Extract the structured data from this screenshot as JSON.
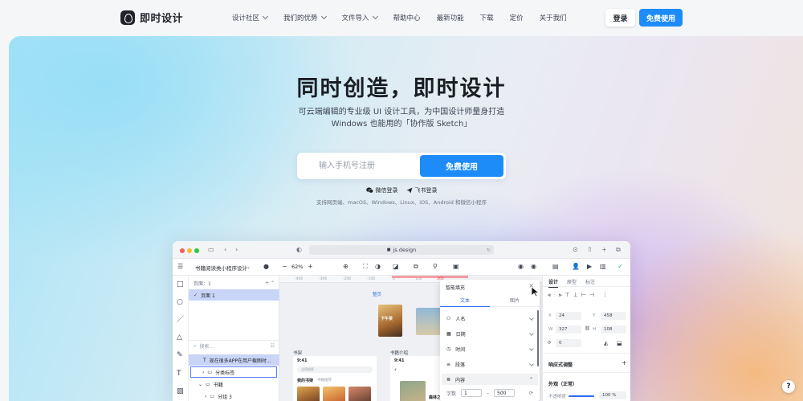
{
  "brand": {
    "name": "即时设计"
  },
  "nav": {
    "items": [
      {
        "label": "设计社区",
        "has_dropdown": true
      },
      {
        "label": "我们的优势",
        "has_dropdown": true
      },
      {
        "label": "文件导入",
        "has_dropdown": true
      },
      {
        "label": "帮助中心",
        "has_dropdown": false
      },
      {
        "label": "最新功能",
        "has_dropdown": false
      },
      {
        "label": "下载",
        "has_dropdown": false
      },
      {
        "label": "定价",
        "has_dropdown": false
      },
      {
        "label": "关于我们",
        "has_dropdown": false
      }
    ],
    "login_label": "登录",
    "free_label": "免费使用"
  },
  "hero": {
    "title": "同时创造，即时设计",
    "subtitle_line1": "可云端编辑的专业级 UI 设计工具，为中国设计师量身打造",
    "subtitle_line2": "Windows 也能用的「协作版 Sketch」",
    "phone_placeholder": "输入手机号注册",
    "cta_label": "免费使用",
    "wechat_login": "微信登录",
    "feishu_login": "飞书登录",
    "platforms": "支持网页端、macOS、Windows、Linux、iOS、Android 和微信小程序"
  },
  "app": {
    "url": "js.design",
    "file_name": "书籍阅读类小程序设计",
    "zoom": "62%",
    "pages_label": "页面：1",
    "page_item": "页面 1",
    "search_placeholder": "搜索...",
    "layers": [
      "现在很多APP在用户截图时...",
      "分类标签",
      "书籍",
      "分组 3"
    ],
    "ruler_ticks": [
      "-400",
      "-300",
      "-200",
      "-100",
      "0",
      "100",
      "24",
      "200"
    ],
    "canvas_labels": {
      "frame1": "书架",
      "frame2": "书籍介绍",
      "tag": "整页",
      "status_time": "9:41",
      "search_hint": "全网搜索",
      "tab1": "我的书架",
      "tab2": "书籍推荐",
      "book_title": "森林之",
      "book_cover": "下午茶"
    },
    "fill_panel": {
      "title": "智能填充",
      "tab_text": "文本",
      "tab_image": "图片",
      "rows": [
        "人名",
        "日期",
        "时间",
        "段落",
        "内容"
      ],
      "count_label": "字数",
      "count_min": "1",
      "count_max": "500"
    },
    "right_panel": {
      "tabs": [
        "设计",
        "原型",
        "标注"
      ],
      "x": "24",
      "y": "458",
      "w": "327",
      "h": "108",
      "rotation": "0",
      "responsive_label": "响应式调整",
      "appearance_label": "外观（正常）",
      "opacity_label": "不透明度",
      "opacity_value": "100 %"
    }
  },
  "colors": {
    "accent": "#1d8cf8",
    "text": "#1f2329"
  }
}
